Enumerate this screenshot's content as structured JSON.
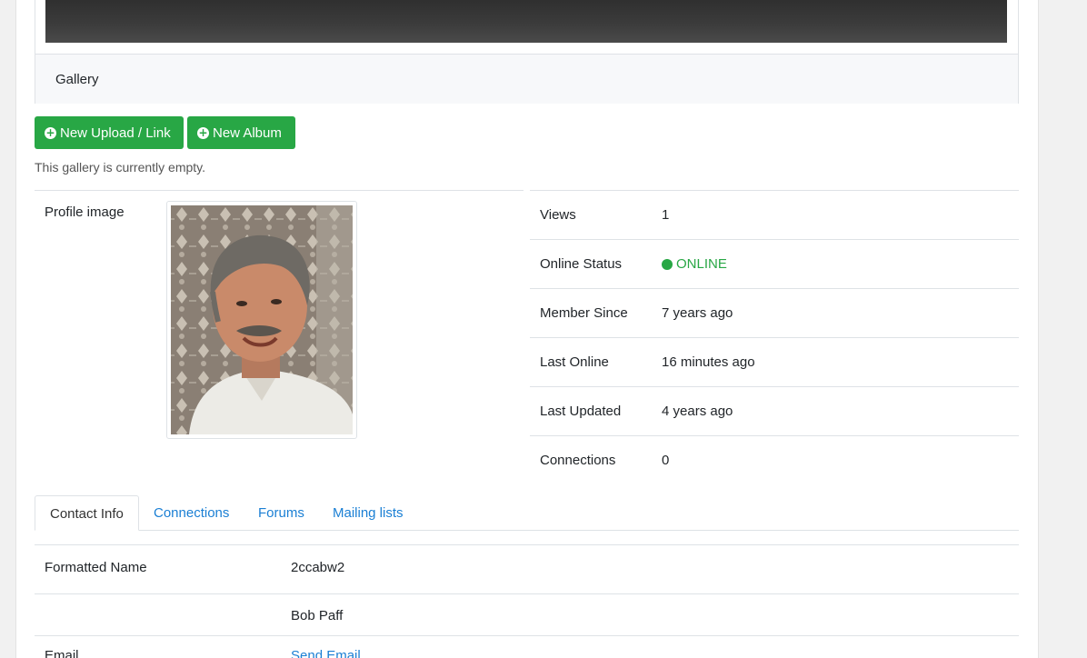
{
  "gallery": {
    "title": "Gallery",
    "new_upload_label": "New Upload / Link",
    "new_album_label": "New Album",
    "empty_message": "This gallery is currently empty."
  },
  "profile": {
    "image_label": "Profile image"
  },
  "stats": [
    {
      "label": "Views",
      "value": "1"
    },
    {
      "label": "Online Status",
      "value": "ONLINE"
    },
    {
      "label": "Member Since",
      "value": "7 years ago"
    },
    {
      "label": "Last Online",
      "value": "16 minutes ago"
    },
    {
      "label": "Last Updated",
      "value": "4 years ago"
    },
    {
      "label": "Connections",
      "value": "0"
    }
  ],
  "tabs": [
    {
      "label": "Contact Info",
      "active": true
    },
    {
      "label": "Connections",
      "active": false
    },
    {
      "label": "Forums",
      "active": false
    },
    {
      "label": "Mailing lists",
      "active": false
    }
  ],
  "contact": {
    "rows": [
      {
        "label": "Formatted Name",
        "value": "2ccabw2"
      },
      {
        "label": "",
        "value": "Bob Paff"
      },
      {
        "label": "Email",
        "value": "Send Email"
      }
    ]
  },
  "colors": {
    "accent_green": "#28a745",
    "link_blue": "#1a7fd4"
  },
  "icons": [
    "plus-circle-icon",
    "online-status-dot-icon"
  ]
}
